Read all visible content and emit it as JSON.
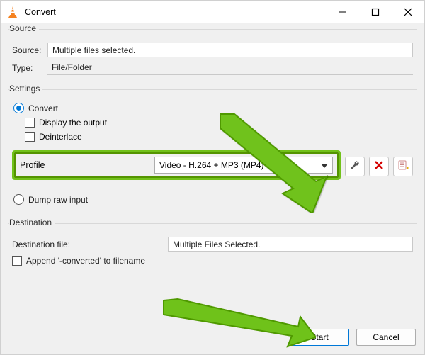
{
  "window": {
    "title": "Convert"
  },
  "source": {
    "legend": "Source",
    "source_label": "Source:",
    "source_value": "Multiple files selected.",
    "type_label": "Type:",
    "type_value": "File/Folder"
  },
  "settings": {
    "legend": "Settings",
    "convert_label": "Convert",
    "display_output_label": "Display the output",
    "deinterlace_label": "Deinterlace",
    "profile_label": "Profile",
    "profile_value": "Video - H.264 + MP3 (MP4)",
    "dump_label": "Dump raw input"
  },
  "destination": {
    "legend": "Destination",
    "file_label": "Destination file:",
    "file_value": "Multiple Files Selected.",
    "append_label": "Append '-converted' to filename"
  },
  "buttons": {
    "start": "Start",
    "cancel": "Cancel"
  },
  "icons": {
    "wrench": "wrench-icon",
    "delete": "delete-icon",
    "new_profile": "new-profile-icon"
  }
}
